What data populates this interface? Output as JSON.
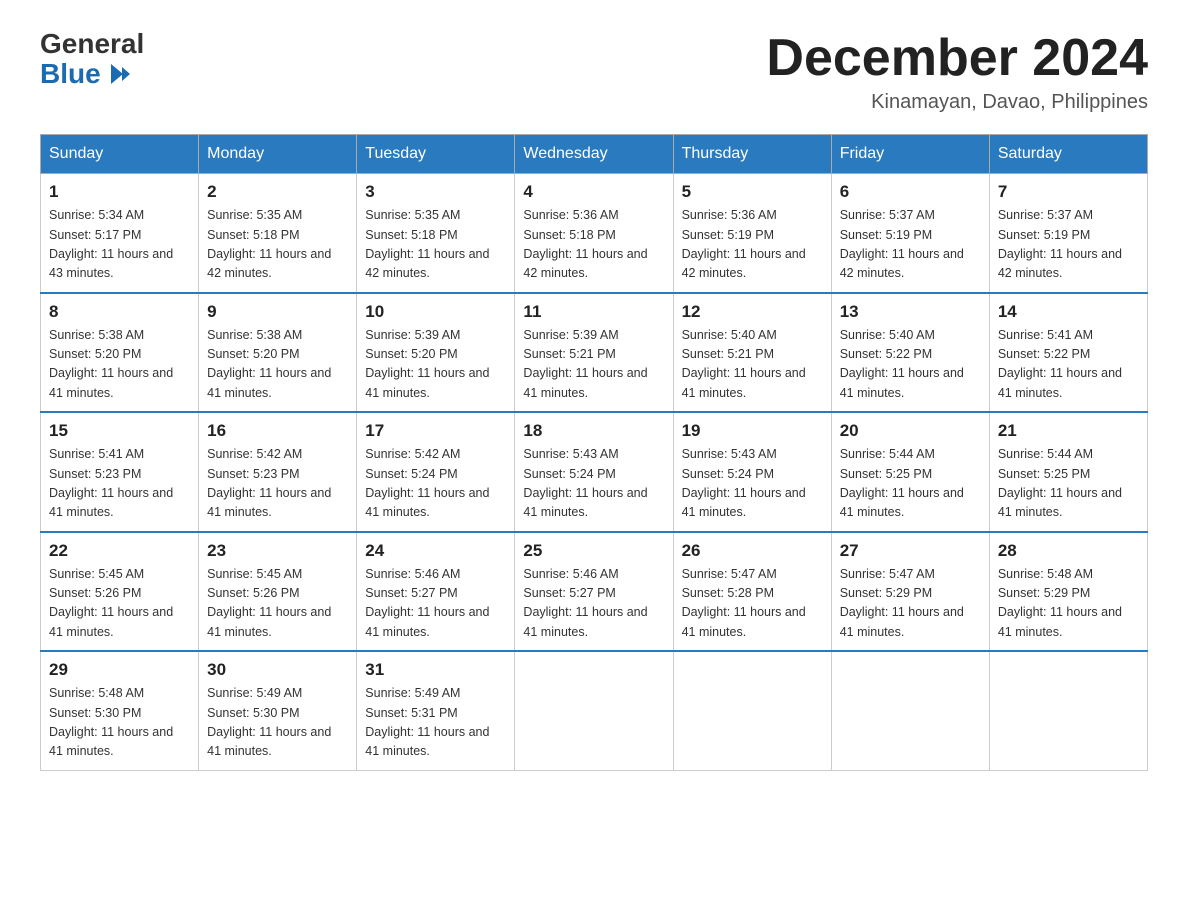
{
  "header": {
    "logo_general": "General",
    "logo_blue": "Blue",
    "month_title": "December 2024",
    "location": "Kinamayan, Davao, Philippines"
  },
  "days_of_week": [
    "Sunday",
    "Monday",
    "Tuesday",
    "Wednesday",
    "Thursday",
    "Friday",
    "Saturday"
  ],
  "weeks": [
    [
      {
        "day": "1",
        "sunrise": "5:34 AM",
        "sunset": "5:17 PM",
        "daylight": "11 hours and 43 minutes."
      },
      {
        "day": "2",
        "sunrise": "5:35 AM",
        "sunset": "5:18 PM",
        "daylight": "11 hours and 42 minutes."
      },
      {
        "day": "3",
        "sunrise": "5:35 AM",
        "sunset": "5:18 PM",
        "daylight": "11 hours and 42 minutes."
      },
      {
        "day": "4",
        "sunrise": "5:36 AM",
        "sunset": "5:18 PM",
        "daylight": "11 hours and 42 minutes."
      },
      {
        "day": "5",
        "sunrise": "5:36 AM",
        "sunset": "5:19 PM",
        "daylight": "11 hours and 42 minutes."
      },
      {
        "day": "6",
        "sunrise": "5:37 AM",
        "sunset": "5:19 PM",
        "daylight": "11 hours and 42 minutes."
      },
      {
        "day": "7",
        "sunrise": "5:37 AM",
        "sunset": "5:19 PM",
        "daylight": "11 hours and 42 minutes."
      }
    ],
    [
      {
        "day": "8",
        "sunrise": "5:38 AM",
        "sunset": "5:20 PM",
        "daylight": "11 hours and 41 minutes."
      },
      {
        "day": "9",
        "sunrise": "5:38 AM",
        "sunset": "5:20 PM",
        "daylight": "11 hours and 41 minutes."
      },
      {
        "day": "10",
        "sunrise": "5:39 AM",
        "sunset": "5:20 PM",
        "daylight": "11 hours and 41 minutes."
      },
      {
        "day": "11",
        "sunrise": "5:39 AM",
        "sunset": "5:21 PM",
        "daylight": "11 hours and 41 minutes."
      },
      {
        "day": "12",
        "sunrise": "5:40 AM",
        "sunset": "5:21 PM",
        "daylight": "11 hours and 41 minutes."
      },
      {
        "day": "13",
        "sunrise": "5:40 AM",
        "sunset": "5:22 PM",
        "daylight": "11 hours and 41 minutes."
      },
      {
        "day": "14",
        "sunrise": "5:41 AM",
        "sunset": "5:22 PM",
        "daylight": "11 hours and 41 minutes."
      }
    ],
    [
      {
        "day": "15",
        "sunrise": "5:41 AM",
        "sunset": "5:23 PM",
        "daylight": "11 hours and 41 minutes."
      },
      {
        "day": "16",
        "sunrise": "5:42 AM",
        "sunset": "5:23 PM",
        "daylight": "11 hours and 41 minutes."
      },
      {
        "day": "17",
        "sunrise": "5:42 AM",
        "sunset": "5:24 PM",
        "daylight": "11 hours and 41 minutes."
      },
      {
        "day": "18",
        "sunrise": "5:43 AM",
        "sunset": "5:24 PM",
        "daylight": "11 hours and 41 minutes."
      },
      {
        "day": "19",
        "sunrise": "5:43 AM",
        "sunset": "5:24 PM",
        "daylight": "11 hours and 41 minutes."
      },
      {
        "day": "20",
        "sunrise": "5:44 AM",
        "sunset": "5:25 PM",
        "daylight": "11 hours and 41 minutes."
      },
      {
        "day": "21",
        "sunrise": "5:44 AM",
        "sunset": "5:25 PM",
        "daylight": "11 hours and 41 minutes."
      }
    ],
    [
      {
        "day": "22",
        "sunrise": "5:45 AM",
        "sunset": "5:26 PM",
        "daylight": "11 hours and 41 minutes."
      },
      {
        "day": "23",
        "sunrise": "5:45 AM",
        "sunset": "5:26 PM",
        "daylight": "11 hours and 41 minutes."
      },
      {
        "day": "24",
        "sunrise": "5:46 AM",
        "sunset": "5:27 PM",
        "daylight": "11 hours and 41 minutes."
      },
      {
        "day": "25",
        "sunrise": "5:46 AM",
        "sunset": "5:27 PM",
        "daylight": "11 hours and 41 minutes."
      },
      {
        "day": "26",
        "sunrise": "5:47 AM",
        "sunset": "5:28 PM",
        "daylight": "11 hours and 41 minutes."
      },
      {
        "day": "27",
        "sunrise": "5:47 AM",
        "sunset": "5:29 PM",
        "daylight": "11 hours and 41 minutes."
      },
      {
        "day": "28",
        "sunrise": "5:48 AM",
        "sunset": "5:29 PM",
        "daylight": "11 hours and 41 minutes."
      }
    ],
    [
      {
        "day": "29",
        "sunrise": "5:48 AM",
        "sunset": "5:30 PM",
        "daylight": "11 hours and 41 minutes."
      },
      {
        "day": "30",
        "sunrise": "5:49 AM",
        "sunset": "5:30 PM",
        "daylight": "11 hours and 41 minutes."
      },
      {
        "day": "31",
        "sunrise": "5:49 AM",
        "sunset": "5:31 PM",
        "daylight": "11 hours and 41 minutes."
      },
      null,
      null,
      null,
      null
    ]
  ]
}
